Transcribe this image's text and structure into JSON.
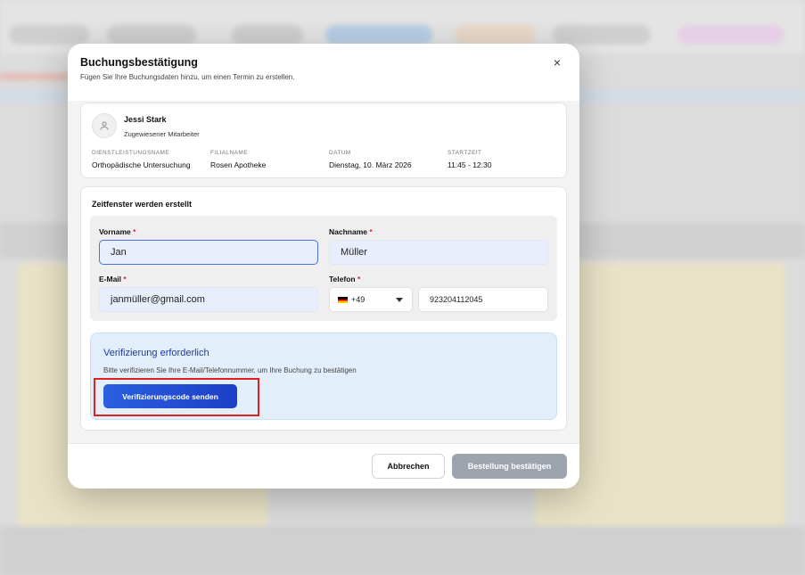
{
  "modal": {
    "title": "Buchungsbestätigung",
    "subtitle": "Fügen Sie Ihre Buchungsdaten hinzu, um einen Termin zu erstellen.",
    "close_icon": "×"
  },
  "employee": {
    "name": "Jessi Stark",
    "role": "Zugewiesener Mitarbeiter",
    "avatar_icon": "user-icon"
  },
  "booking_info": [
    {
      "label": "DIENSTLEISTUNGSNAME",
      "value": "Orthopädische Untersuchung"
    },
    {
      "label": "FILIALNAME",
      "value": "Rosen Apotheke"
    },
    {
      "label": "DATUM",
      "value": "Dienstag, 10. März 2026"
    },
    {
      "label": "STARTZEIT",
      "value": "11:45 - 12:30"
    }
  ],
  "form": {
    "section_title": "Zeitfenster werden erstellt",
    "first_name": {
      "label": "Vorname",
      "value": "Jan"
    },
    "last_name": {
      "label": "Nachname",
      "value": "Müller"
    },
    "email": {
      "label": "E-Mail",
      "value": "janmüller@gmail.com"
    },
    "phone": {
      "label": "Telefon",
      "country_code": "+49",
      "value": "923204112045"
    },
    "required_mark": "*"
  },
  "verification": {
    "title": "Verifizierung erforderlich",
    "text": "Bitte verifizieren Sie Ihre E-Mail/Telefonnummer, um Ihre Buchung zu bestätigen",
    "button_label": "Verifizierungscode senden"
  },
  "footer": {
    "cancel_label": "Abbrechen",
    "confirm_label": "Bestellung bestätigen"
  },
  "colors": {
    "accent": "#2b5fe0",
    "highlight": "#e02020",
    "disabled_button": "#9ea4ad"
  }
}
